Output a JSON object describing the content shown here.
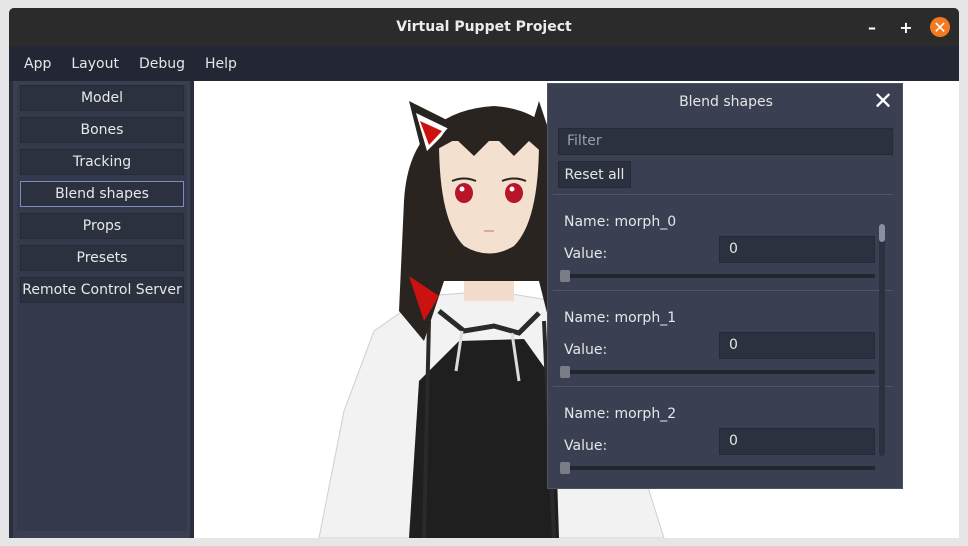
{
  "window": {
    "title": "Virtual Puppet Project"
  },
  "menu": [
    "App",
    "Layout",
    "Debug",
    "Help"
  ],
  "sidebar": {
    "items": [
      {
        "label": "Model",
        "active": false
      },
      {
        "label": "Bones",
        "active": false
      },
      {
        "label": "Tracking",
        "active": false
      },
      {
        "label": "Blend shapes",
        "active": true
      },
      {
        "label": "Props",
        "active": false
      },
      {
        "label": "Presets",
        "active": false
      },
      {
        "label": "Remote Control Server",
        "active": false
      }
    ]
  },
  "blend_panel": {
    "title": "Blend shapes",
    "filter_placeholder": "Filter",
    "reset_label": "Reset all",
    "morphs": [
      {
        "name": "Name: morph_0",
        "value_label": "Value:",
        "value": "0",
        "slider_fraction": 0
      },
      {
        "name": "Name: morph_1",
        "value_label": "Value:",
        "value": "0",
        "slider_fraction": 0
      },
      {
        "name": "Name: morph_2",
        "value_label": "Value:",
        "value": "0",
        "slider_fraction": 0
      }
    ]
  },
  "colors": {
    "accent_close": "#f37a1f",
    "panel_bg": "#3a3f52",
    "menubar_bg": "#232735",
    "active_border": "#7a8dbd"
  }
}
